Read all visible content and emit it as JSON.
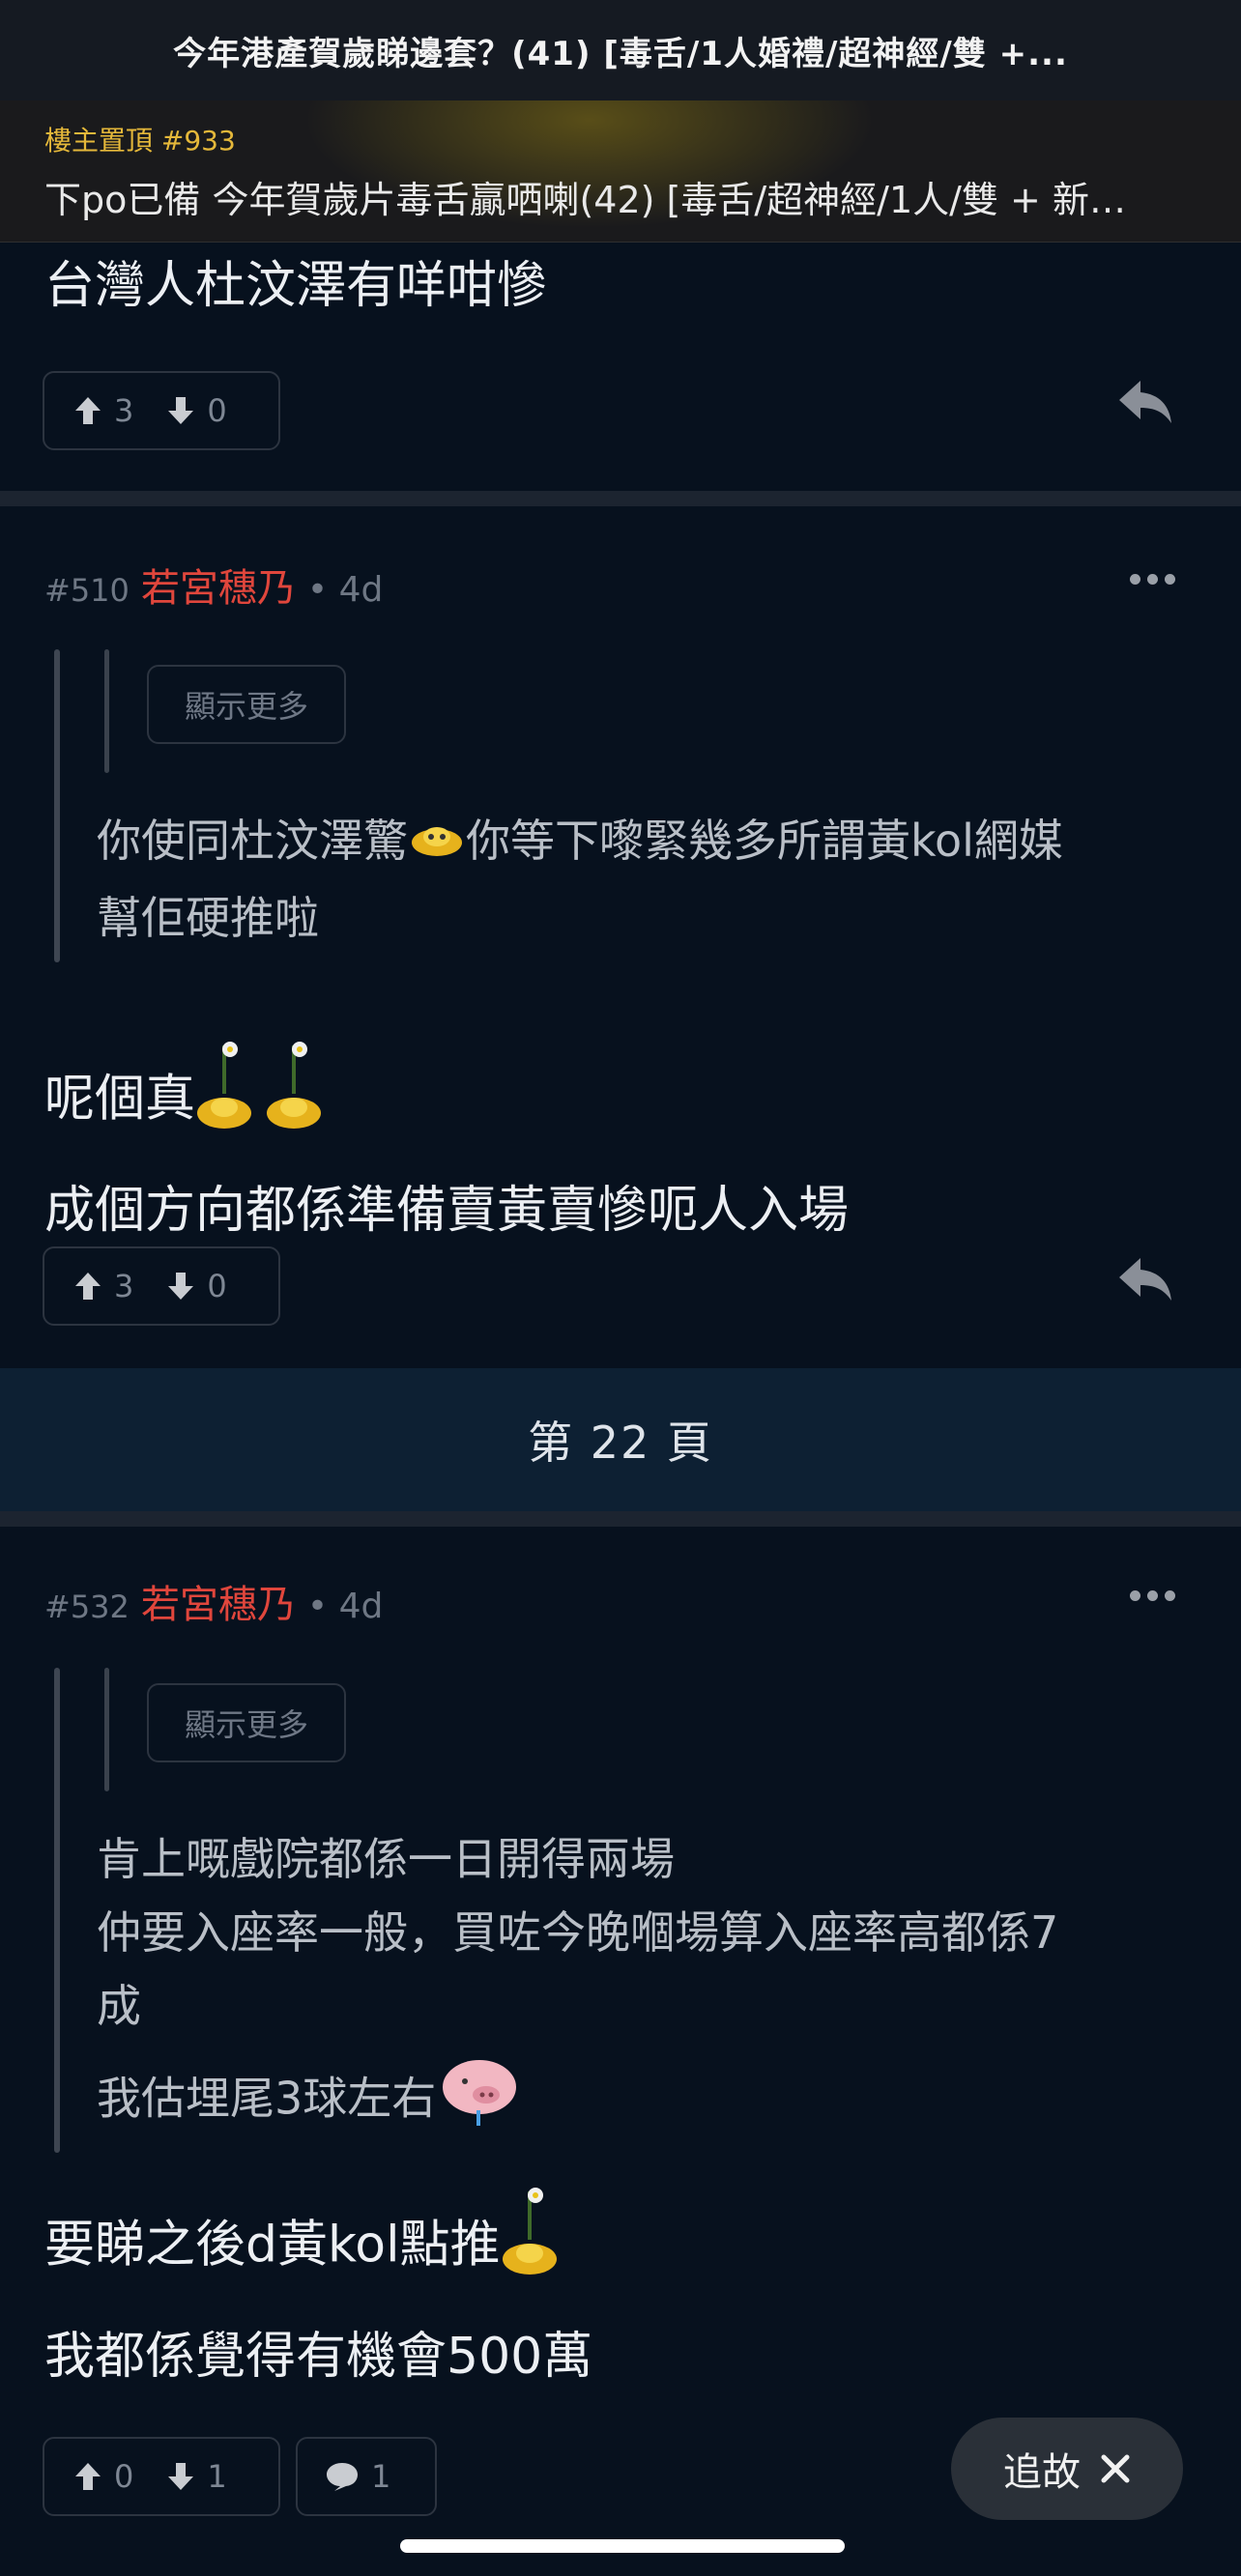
{
  "topbar": {
    "title": "今年港產賀歲睇邊套？(41) [毒舌/1人婚禮/超神經/雙 +..."
  },
  "pinned": {
    "label": "樓主置頂 #933",
    "text": "下po已備 今年賀歲片毒舌贏哂喇(42) [毒舌/超神經/1人/雙 + 新…"
  },
  "post_prev": {
    "text": "台灣人杜汶澤有咩咁慘",
    "upvotes": "3",
    "downvotes": "0"
  },
  "post_510": {
    "number": "#510",
    "user": "若宮穗乃",
    "time": "• 4d",
    "show_more": "顯示更多",
    "quote_line1": "你使同杜汶澤驚",
    "quote_line1b": "你等下嚟緊幾多所謂黃kol網媒",
    "quote_line2": "幫佢硬推啦",
    "body_line1": "呢個真",
    "body_line2": "成個方向都係準備賣黃賣慘呃人入場",
    "upvotes": "3",
    "downvotes": "0"
  },
  "page_bar": {
    "label": "第 22 頁"
  },
  "post_532": {
    "number": "#532",
    "user": "若宮穗乃",
    "time": "• 4d",
    "show_more": "顯示更多",
    "quote_line1": "肯上嘅戲院都係一日開得兩場",
    "quote_line2": "仲要入座率一般，買咗今晚嗰場算入座率高都係7",
    "quote_line3": "成",
    "quote_line4": "我估埋尾3球左右",
    "body_line1": "要睇之後d黃kol點推",
    "body_line2": "我都係覺得有機會500萬",
    "upvotes": "0",
    "downvotes": "1",
    "replies": "1"
  },
  "follow_button": {
    "label": "追故"
  },
  "colors": {
    "username": "#e0463c",
    "pinned_label": "#e5b83a",
    "background": "#07111e"
  }
}
